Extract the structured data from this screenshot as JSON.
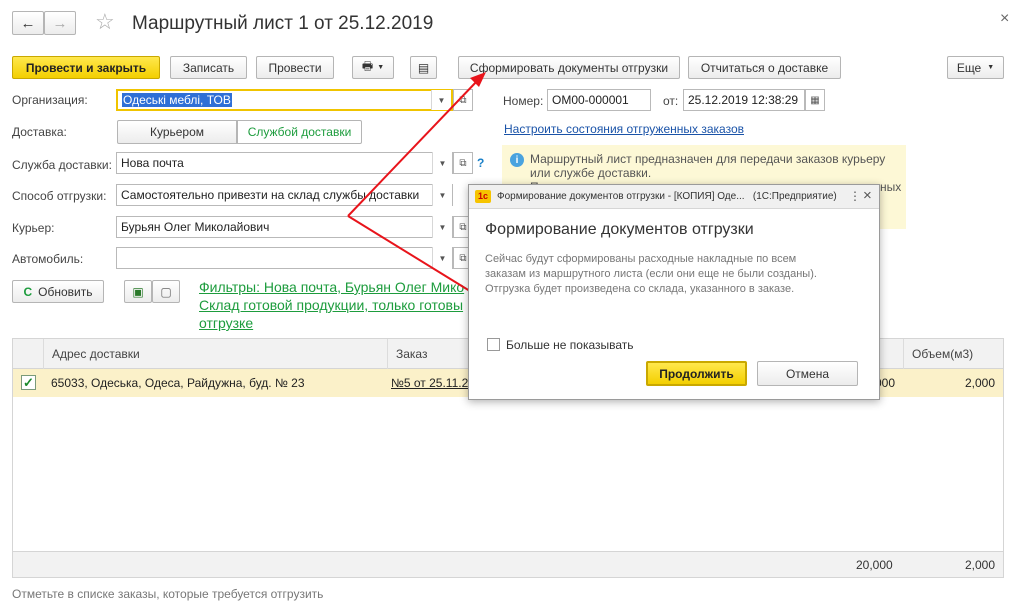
{
  "window": {
    "title": "Маршрутный лист 1 от 25.12.2019",
    "back_icon": "←",
    "forward_icon": "→",
    "star_icon": "☆",
    "close_icon": "×"
  },
  "toolbar": {
    "post_close": "Провести и закрыть",
    "save": "Записать",
    "post": "Провести",
    "print_icon": "🖶",
    "doc_icon": "▤",
    "form_docs": "Сформировать документы отгрузки",
    "report_delivery": "Отчитаться о доставке",
    "more": "Еще"
  },
  "form": {
    "org_label": "Организация:",
    "org_value": "Одеські меблі, ТОВ",
    "number_label": "Номер:",
    "number_value": "ОМ00-000001",
    "date_label": "от:",
    "date_value": "25.12.2019 12:38:29",
    "delivery_label": "Доставка:",
    "delivery_courier": "Курьером",
    "delivery_service": "Службой доставки",
    "configure_link": "Настроить состояния отгруженных заказов",
    "service_label": "Служба доставки:",
    "service_value": "Нова почта",
    "help_icon": "?",
    "ship_method_label": "Способ отгрузки:",
    "ship_method_value": "Самостоятельно привезти на склад службы доставки",
    "courier_label": "Курьер:",
    "courier_value": "Бурьян Олег Миколайович",
    "car_label": "Автомобиль:",
    "car_value": "",
    "info_text_1": "Маршрутный лист предназначен для передачи заказов курьеру",
    "info_text_2": "или службе доставки.",
    "info_text_3": "П",
    "info_text_tail": "ных"
  },
  "actions": {
    "refresh": "Обновить",
    "filters_line1": "Фильтры: Нова почта, Бурьян Олег Мико",
    "filters_line2": "Склад готовой продукции, только готовы",
    "filters_line3": "отгрузке"
  },
  "table": {
    "headers": [
      "Адрес доставки",
      "Заказ",
      "Объем(м3)"
    ],
    "rows": [
      {
        "checked": true,
        "address": "65033, Одеська, Одеса, Райдужна, буд. № 23",
        "order": "№5 от 25.11.2",
        "col_hidden": "000",
        "volume": "2,000"
      }
    ],
    "footer_left": "20,000",
    "footer_right": "2,000"
  },
  "status_hint": "Отметьте в списке заказы, которые требуется отгрузить",
  "dialog": {
    "app_icon": "1с",
    "title": "Формирование документов отгрузки - [КОПИЯ] Оде...   (1С:Предприятие)",
    "more_icon": "⋮",
    "close_icon": "×",
    "heading": "Формирование документов отгрузки",
    "body_1": "Сейчас будут сформированы расходные накладные по всем",
    "body_2": "заказам из маршрутного листа (если они еще не были созданы).",
    "body_3": "Отгрузка будет произведена со склада, указанного в заказе.",
    "checkbox_label": "Больше не показывать",
    "continue": "Продолжить",
    "cancel": "Отмена"
  },
  "colors": {
    "accent_yellow": "#f3cf00",
    "arrow_red": "#e8141b",
    "link_blue": "#1a53a8",
    "link_green": "#1d9c3d",
    "info_bg": "#fdf8d6",
    "row_highlight": "#fbf1c9"
  }
}
